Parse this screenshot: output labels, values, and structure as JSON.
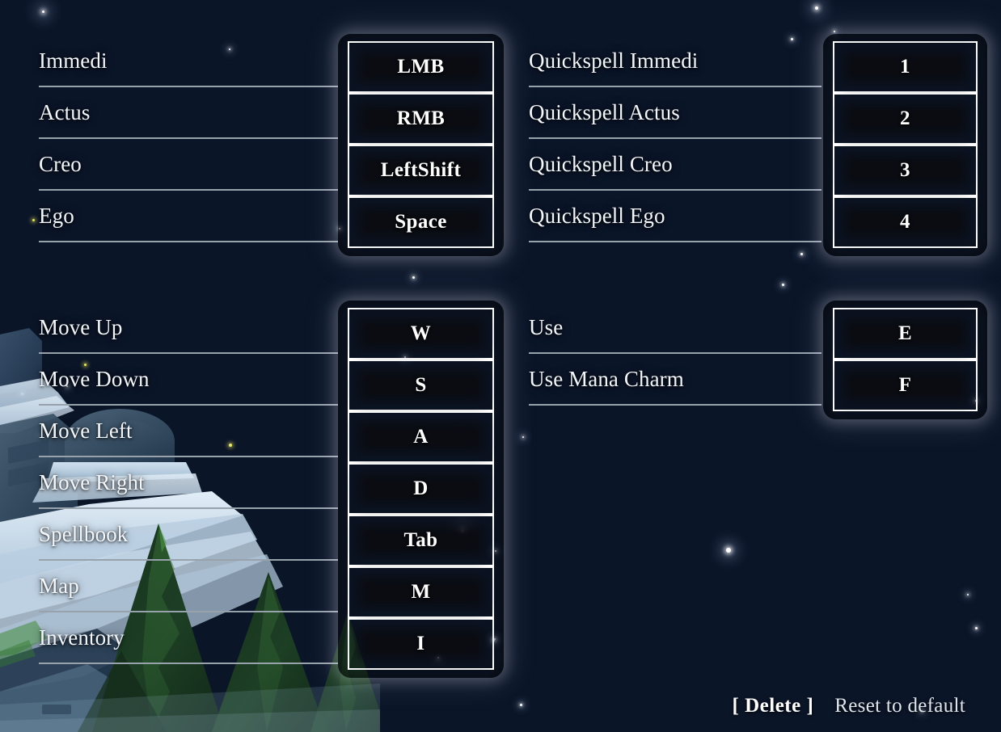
{
  "theme": {
    "background_dark": "#0a1120",
    "background_mid": "#0d1a30",
    "divider_color": "#98a2ad",
    "text_color": "#f3f6fa",
    "key_border_color": "#ffffff",
    "key_inner_color": "#0a0c12"
  },
  "sections": {
    "spells": {
      "rows": [
        {
          "action": "Immedi",
          "key": "LMB"
        },
        {
          "action": "Actus",
          "key": "RMB"
        },
        {
          "action": "Creo",
          "key": "LeftShift"
        },
        {
          "action": "Ego",
          "key": "Space"
        }
      ]
    },
    "quickspells": {
      "rows": [
        {
          "action": "Quickspell Immedi",
          "key": "1"
        },
        {
          "action": "Quickspell Actus",
          "key": "2"
        },
        {
          "action": "Quickspell Creo",
          "key": "3"
        },
        {
          "action": "Quickspell Ego",
          "key": "4"
        }
      ]
    },
    "movement": {
      "rows": [
        {
          "action": "Move Up",
          "key": "W"
        },
        {
          "action": "Move Down",
          "key": "S"
        },
        {
          "action": "Move Left",
          "key": "A"
        },
        {
          "action": "Move Right",
          "key": "D"
        },
        {
          "action": "Spellbook",
          "key": "Tab"
        },
        {
          "action": "Map",
          "key": "M"
        },
        {
          "action": "Inventory",
          "key": "I"
        }
      ]
    },
    "interact": {
      "rows": [
        {
          "action": "Use",
          "key": "E"
        },
        {
          "action": "Use Mana Charm",
          "key": "F"
        }
      ]
    }
  },
  "footer": {
    "delete_label": "[ Delete ]",
    "reset_label": "Reset to default"
  }
}
